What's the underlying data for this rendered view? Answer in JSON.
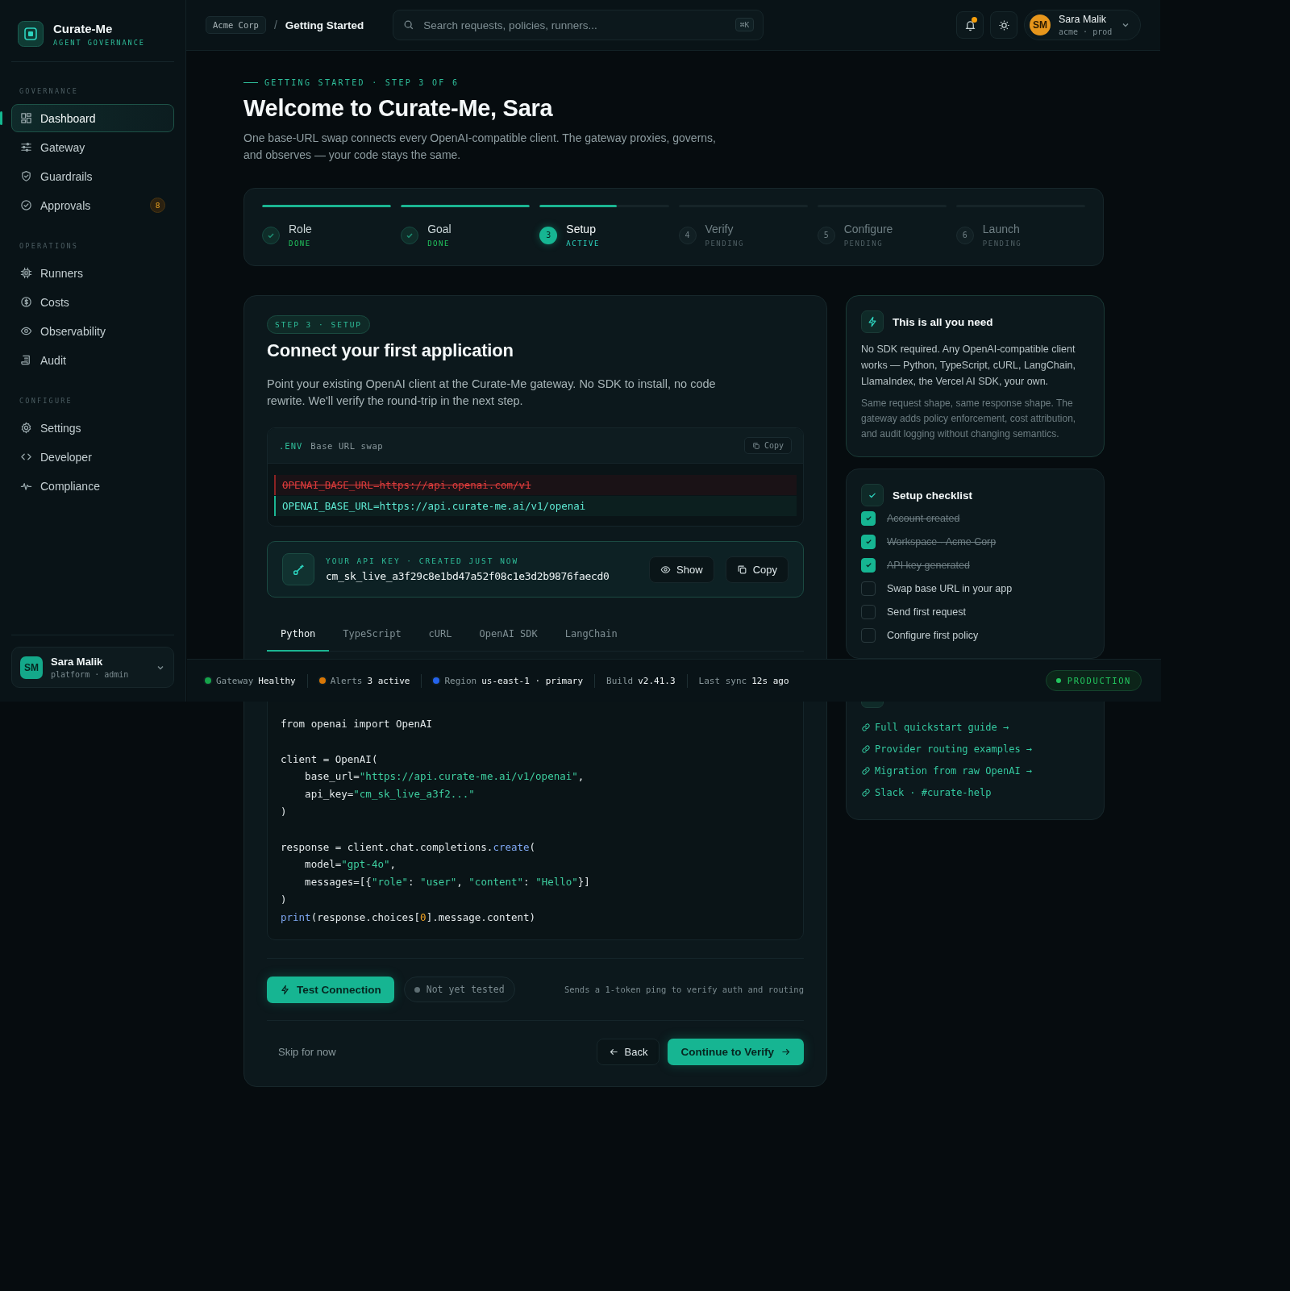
{
  "sidebar": {
    "brand": "Curate-Me",
    "tagline": "AGENT GOVERNANCE",
    "sections": [
      {
        "title": "GOVERNANCE",
        "items": [
          {
            "label": "Dashboard",
            "selected": true
          },
          {
            "label": "Gateway",
            "selected": false
          },
          {
            "label": "Guardrails",
            "selected": false
          },
          {
            "label": "Approvals",
            "selected": false,
            "badge": "8"
          }
        ]
      },
      {
        "title": "OPERATIONS",
        "items": [
          {
            "label": "Runners",
            "selected": false
          },
          {
            "label": "Costs",
            "selected": false
          },
          {
            "label": "Observability",
            "selected": false
          },
          {
            "label": "Audit",
            "selected": false
          }
        ]
      },
      {
        "title": "CONFIGURE",
        "items": [
          {
            "label": "Settings",
            "selected": false
          },
          {
            "label": "Developer",
            "selected": false
          },
          {
            "label": "Compliance",
            "selected": false
          }
        ]
      }
    ],
    "user": {
      "initials": "SM",
      "name": "Sara Malik",
      "role": "platform · admin"
    }
  },
  "header": {
    "org": "Acme Corp",
    "separator": "/",
    "page": "Getting Started",
    "search": {
      "placeholder": "Search requests, policies, runners...",
      "shortcut": "⌘K"
    },
    "notifications": {
      "unread": true
    },
    "user": {
      "initials": "SM",
      "name": "Sara Malik",
      "sub": "acme · prod"
    }
  },
  "intro": {
    "eyebrow": "GETTING STARTED · STEP 3 OF 6",
    "title": "Welcome to Curate-Me, Sara",
    "description": "One base-URL swap connects every OpenAI-compatible client. The gateway proxies, governs, and observes — your code stays the same."
  },
  "steps": [
    {
      "label": "Role",
      "status": "DONE",
      "level": 1
    },
    {
      "label": "Goal",
      "status": "DONE",
      "level": 1
    },
    {
      "label": "Setup",
      "status": "ACTIVE",
      "number": "3",
      "level": 0.6
    },
    {
      "label": "Verify",
      "status": "PENDING",
      "number": "4",
      "level": 0
    },
    {
      "label": "Configure",
      "status": "PENDING",
      "number": "5",
      "level": 0
    },
    {
      "label": "Launch",
      "status": "PENDING",
      "number": "6",
      "level": 0
    }
  ],
  "setup": {
    "pill": "STEP 3 · SETUP",
    "title": "Connect your first application",
    "description": "Point your existing OpenAI client at the Curate-Me gateway. No SDK to install, no code rewrite. We'll verify the round-trip in the next step.",
    "env": {
      "file": ".ENV",
      "caption": "Base URL swap",
      "copy": "Copy",
      "lines": [
        {
          "kind": "removed",
          "text": "OPENAI_BASE_URL=https://api.openai.com/v1"
        },
        {
          "kind": "added",
          "text": "OPENAI_BASE_URL=https://api.curate-me.ai/v1/openai"
        }
      ]
    },
    "api_key": {
      "label": "YOUR API KEY · CREATED JUST NOW",
      "value": "cm_sk_live_a3f29c8e1bd47a52f08c1e3d2b9876faecd0",
      "show": "Show",
      "copy": "Copy"
    },
    "tabs": [
      {
        "label": "Python",
        "selected": true
      },
      {
        "label": "TypeScript",
        "selected": false
      },
      {
        "label": "cURL",
        "selected": false
      },
      {
        "label": "OpenAI SDK",
        "selected": false
      },
      {
        "label": "LangChain",
        "selected": false
      }
    ],
    "code": [
      {
        "lines": [
          {
            "tokens": [
              {
                "kind": "plain",
                "text": "from openai import OpenAI"
              }
            ]
          }
        ]
      },
      {
        "lines": [
          {
            "tokens": [
              {
                "kind": "plain",
                "text": "client = OpenAI("
              }
            ]
          },
          {
            "tokens": [
              {
                "kind": "plain",
                "text": "    base_url="
              },
              {
                "kind": "string",
                "text": "\"https://api.curate-me.ai/v1/openai\""
              },
              {
                "kind": "plain",
                "text": ","
              }
            ]
          },
          {
            "tokens": [
              {
                "kind": "plain",
                "text": "    api_key="
              },
              {
                "kind": "string",
                "text": "\"cm_sk_live_a3f2...\""
              }
            ]
          },
          {
            "tokens": [
              {
                "kind": "plain",
                "text": ")"
              }
            ]
          }
        ]
      },
      {
        "lines": [
          {
            "tokens": [
              {
                "kind": "plain",
                "text": "response = client.chat.completions."
              },
              {
                "kind": "function",
                "text": "create"
              },
              {
                "kind": "plain",
                "text": "("
              }
            ]
          },
          {
            "tokens": [
              {
                "kind": "plain",
                "text": "    model="
              },
              {
                "kind": "string",
                "text": "\"gpt-4o\""
              },
              {
                "kind": "plain",
                "text": ","
              }
            ]
          },
          {
            "tokens": [
              {
                "kind": "plain",
                "text": "    messages=[{"
              },
              {
                "kind": "string",
                "text": "\"role\""
              },
              {
                "kind": "plain",
                "text": ": "
              },
              {
                "kind": "string",
                "text": "\"user\""
              },
              {
                "kind": "plain",
                "text": ", "
              },
              {
                "kind": "string",
                "text": "\"content\""
              },
              {
                "kind": "plain",
                "text": ": "
              },
              {
                "kind": "string",
                "text": "\"Hello\""
              },
              {
                "kind": "plain",
                "text": "}]"
              }
            ]
          },
          {
            "tokens": [
              {
                "kind": "plain",
                "text": ")"
              }
            ]
          },
          {
            "tokens": [
              {
                "kind": "function",
                "text": "print"
              },
              {
                "kind": "plain",
                "text": "(response.choices["
              },
              {
                "kind": "number",
                "text": "0"
              },
              {
                "kind": "plain",
                "text": "].message.content)"
              }
            ]
          }
        ]
      }
    ],
    "test": {
      "button": "Test Connection",
      "status": "Not yet tested",
      "hint": "Sends a 1-token ping to verify auth and routing"
    },
    "footer": {
      "skip": "Skip for now",
      "back": "Back",
      "next": "Continue to Verify"
    }
  },
  "info": {
    "title": "This is all you need",
    "text": "No SDK required. Any OpenAI-compatible client works — Python, TypeScript, cURL, LangChain, LlamaIndex, the Vercel AI SDK, your own.",
    "note": "Same request shape, same response shape. The gateway adds policy enforcement, cost attribution, and audit logging without changing semantics."
  },
  "checklist": {
    "title": "Setup checklist",
    "items": [
      {
        "label": "Account created",
        "checked": true
      },
      {
        "label": "Workspace · Acme Corp",
        "checked": true
      },
      {
        "label": "API key generated",
        "checked": true
      },
      {
        "label": "Swap base URL in your app",
        "checked": false
      },
      {
        "label": "Send first request",
        "checked": false
      },
      {
        "label": "Configure first policy",
        "checked": false
      }
    ]
  },
  "resources": {
    "links": [
      "Full quickstart guide →",
      "Provider routing examples →",
      "Migration from raw OpenAI →",
      "Slack · #curate-help"
    ]
  },
  "status_bar": {
    "items": [
      {
        "label": "Gateway",
        "value": "Healthy",
        "color": "#16a34a"
      },
      {
        "label": "Alerts",
        "value": "3 active",
        "color": "#d97706"
      },
      {
        "label": "Region",
        "value": "us-east-1 · primary",
        "color": "#2563eb"
      },
      {
        "label": "Build",
        "value": "v2.41.3"
      },
      {
        "label": "Last sync",
        "value": "12s ago"
      }
    ],
    "environment": "PRODUCTION"
  }
}
